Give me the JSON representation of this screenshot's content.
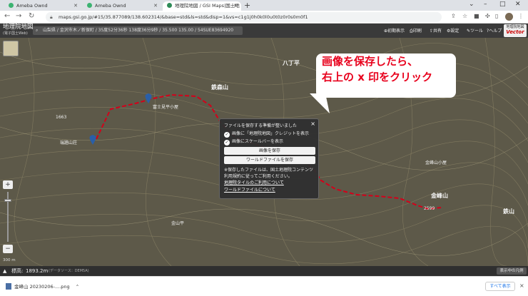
{
  "browser": {
    "tabs": [
      {
        "title": "Ameba Ownd",
        "fav_color": "#3cb371",
        "active": false
      },
      {
        "title": "Ameba Ownd",
        "fav_color": "#3cb371",
        "active": false
      },
      {
        "title": "地理院地図 / GSI Maps|国土地",
        "fav_color": "#2e8b57",
        "active": true
      }
    ],
    "new_tab": "+",
    "url": "maps.gsi.go.jp/#15/35.877089/138.602314/&base=std&ls=std&disp=1&vs=c1g1j0h0k0l0u0t0z0r0s0m0f1"
  },
  "gsi": {
    "logo_main": "地理院地図",
    "logo_sub": "(電子国土Web)",
    "search_text": "山梨県 / 金沢市木ノ新保町 / 35度52分36秒 138度36分9秒 / 35.500 135.00 / 54SUE83694920",
    "header_buttons": [
      "初期表示",
      "印刷",
      "共有",
      "設定",
      "ツール",
      "ヘルプ"
    ],
    "vector_label": "地理院地図",
    "vector_badge": "Vector"
  },
  "map": {
    "labels": [
      {
        "text": "鉄森山",
        "big": true
      },
      {
        "text": "金峰山小屋",
        "big": false
      },
      {
        "text": "金峰山",
        "big": true
      },
      {
        "text": "鉄山",
        "big": true
      },
      {
        "text": "瑞牆山荘",
        "big": false
      },
      {
        "text": "富士見平小屋",
        "big": false
      },
      {
        "text": "金山平",
        "big": false
      },
      {
        "text": "八丁平",
        "big": true
      },
      {
        "text": "2599",
        "big": false
      },
      {
        "text": "1663",
        "big": false
      }
    ],
    "scale": "300 m",
    "zoom_in": "+",
    "zoom_out": "−"
  },
  "callout": {
    "line1": "画像を保存したら、",
    "line2": "右上の x 印をクリック"
  },
  "dialog": {
    "title": "ファイルを保存する準備が整いました",
    "check1": "画像に「地理院地図」クレジットを表示",
    "check2": "画像にスケールバーを表示",
    "btn_save_image": "画像を保存",
    "btn_save_world": "ワールドファイルを保存",
    "note": "※保存したファイルは、国土地理院コンテンツ利用規約に従ってご利用ください。",
    "link1": "地理院タイルのご利用について",
    "link2": "ワールドファイルについて",
    "close": "×"
  },
  "infobar": {
    "elevation_label": "標高:",
    "elevation_value": "1893.2m",
    "elevation_source": "(データソース：DEM5A)",
    "legend_button": "表示中の凡例"
  },
  "downloads": {
    "filename": "金峰山 20230206-....png",
    "show_all": "すべて表示",
    "close": "×"
  },
  "colors": {
    "route": "#d4001a",
    "marker": "#2a5fa8",
    "callout_text": "#e8001c"
  }
}
